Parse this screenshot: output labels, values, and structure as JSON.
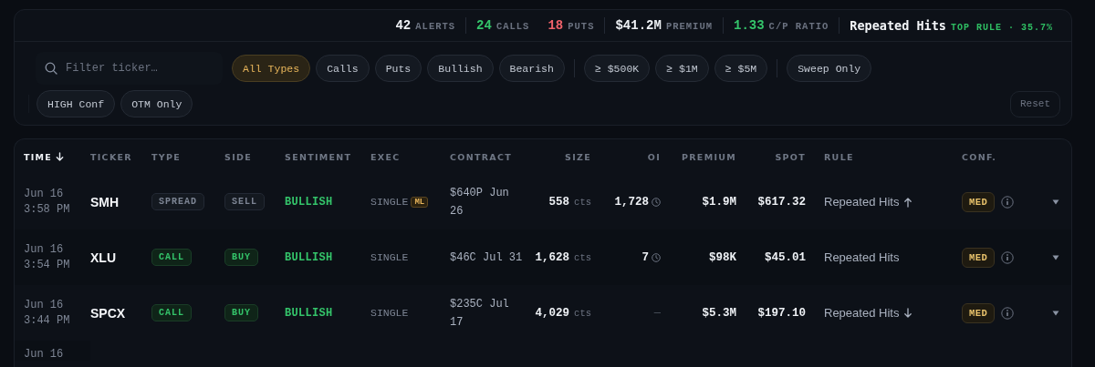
{
  "stat_groups": [
    [
      {
        "kind": "count",
        "value": "42",
        "label": "ALERTS",
        "color": "#eef1f5"
      }
    ],
    [
      {
        "kind": "count",
        "value": "24",
        "label": "CALLS",
        "color": "#34c46a"
      },
      {
        "kind": "count",
        "value": "18",
        "label": "PUTS",
        "color": "#f0626a"
      }
    ],
    [
      {
        "kind": "count",
        "value": "$41.2M",
        "label": "PREMIUM",
        "color": "#eef1f5"
      }
    ],
    [
      {
        "kind": "count",
        "value": "1.33",
        "label": "C/P RATIO",
        "color": "#34c46a"
      }
    ],
    [
      {
        "kind": "rule",
        "value": "Repeated Hits",
        "label": "TOP RULE · 35.7%",
        "color": "#f3f5f8"
      }
    ]
  ],
  "filters": {
    "search": {
      "placeholder": "Filter ticker…"
    },
    "chip_lines": [
      [
        [
          {
            "label": "All Types",
            "selected": true
          },
          {
            "label": "Calls",
            "selected": false
          },
          {
            "label": "Puts",
            "selected": false
          },
          {
            "label": "Bullish",
            "selected": false
          },
          {
            "label": "Bearish",
            "selected": false
          }
        ],
        [
          {
            "label": "≥ $500K",
            "selected": false
          },
          {
            "label": "≥ $1M",
            "selected": false
          },
          {
            "label": "≥ $5M",
            "selected": false
          }
        ],
        [
          {
            "label": "Sweep Only",
            "selected": false
          }
        ]
      ],
      [
        [
          {
            "label": "HIGH Conf",
            "selected": false
          },
          {
            "label": "OTM Only",
            "selected": false
          }
        ]
      ]
    ],
    "reset": "Reset"
  },
  "table": {
    "columns": [
      {
        "label": "TIME",
        "sorted": true
      },
      {
        "label": "TICKER",
        "sorted": false
      },
      {
        "label": "TYPE",
        "sorted": false
      },
      {
        "label": "SIDE",
        "sorted": false
      },
      {
        "label": "SENTIMENT",
        "sorted": false
      },
      {
        "label": "EXEC",
        "sorted": false
      },
      {
        "label": "CONTRACT",
        "sorted": false
      },
      {
        "label": "SIZE",
        "sorted": false
      },
      {
        "label": "OI",
        "sorted": false
      },
      {
        "label": "PREMIUM",
        "sorted": false
      },
      {
        "label": "SPOT",
        "sorted": false
      },
      {
        "label": "RULE",
        "sorted": false
      },
      {
        "label": "CONF.",
        "sorted": false
      }
    ],
    "rows": [
      {
        "date": "Jun 16",
        "time": "3:58 PM",
        "ticker": "SMH",
        "type": {
          "text": "SPREAD",
          "kind": "neutral"
        },
        "side": {
          "text": "SELL",
          "kind": "neutral"
        },
        "sentiment": "BULLISH",
        "exec": "SINGLE",
        "exec_badge": "ML",
        "contract": "$640P Jun 26",
        "size": "558",
        "size_unit": "cts",
        "oi": "1,728",
        "oi_clock": true,
        "premium": "$1.9M",
        "spot": "$617.32",
        "rule": {
          "text": "Repeated Hits",
          "kind": "up"
        },
        "conf": "MED"
      },
      {
        "date": "Jun 16",
        "time": "3:54 PM",
        "ticker": "XLU",
        "type": {
          "text": "CALL",
          "kind": "call"
        },
        "side": {
          "text": "BUY",
          "kind": "buy"
        },
        "sentiment": "BULLISH",
        "exec": "SINGLE",
        "contract": "$46C Jul 31",
        "size": "1,628",
        "size_unit": "cts",
        "oi": "7",
        "oi_clock": true,
        "premium": "$98K",
        "spot": "$45.01",
        "rule": {
          "text": "Repeated Hits",
          "kind": "none"
        },
        "conf": "MED"
      },
      {
        "date": "Jun 16",
        "time": "3:44 PM",
        "ticker": "SPCX",
        "type": {
          "text": "CALL",
          "kind": "call"
        },
        "side": {
          "text": "BUY",
          "kind": "buy"
        },
        "sentiment": "BULLISH",
        "exec": "SINGLE",
        "contract": "$235C Jul 17",
        "size": "4,029",
        "size_unit": "cts",
        "oi": "—",
        "oi_clock": false,
        "premium": "$5.3M",
        "spot": "$197.10",
        "rule": {
          "text": "Repeated Hits",
          "kind": "down"
        },
        "conf": "MED"
      },
      {
        "date": "Jun 16"
      }
    ]
  }
}
